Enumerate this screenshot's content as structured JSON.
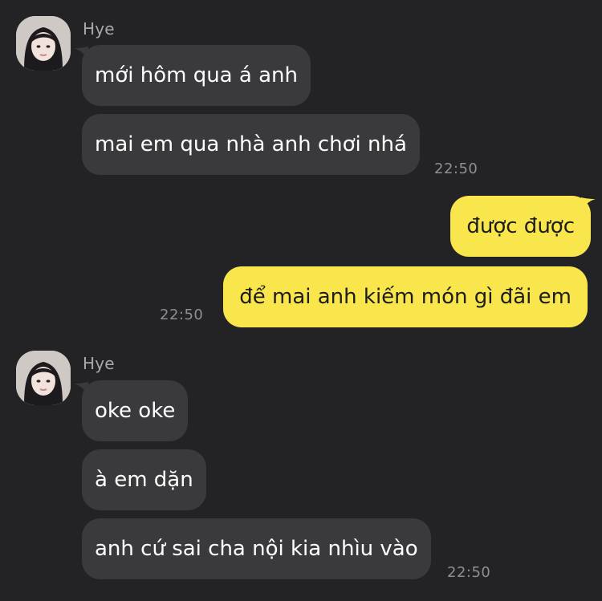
{
  "colors": {
    "background": "#232325",
    "incoming_bubble": "#3a3a3c",
    "outgoing_bubble": "#f9e64c",
    "sender_name": "#a9a9ad",
    "timestamp": "#8e8e93"
  },
  "groups": [
    {
      "sender": "Hye",
      "direction": "incoming",
      "avatar": "profile-photo",
      "messages": [
        "mới hôm qua á anh",
        "mai em qua nhà anh chơi nhá"
      ],
      "time": "22:50"
    },
    {
      "direction": "outgoing",
      "messages": [
        "được được",
        "để mai anh kiếm món gì đãi em"
      ],
      "time": "22:50"
    },
    {
      "sender": "Hye",
      "direction": "incoming",
      "avatar": "profile-photo",
      "messages": [
        "oke oke",
        "à em dặn",
        "anh cứ sai cha nội kia nhìu vào"
      ],
      "time": "22:50"
    }
  ]
}
